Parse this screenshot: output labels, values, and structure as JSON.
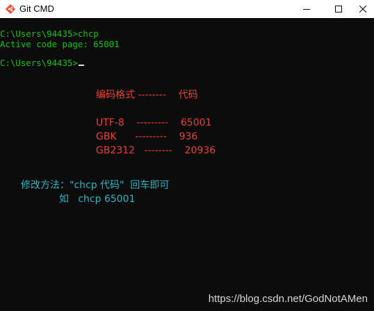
{
  "window": {
    "title": "Git CMD",
    "app_icon": "git-diamond-icon",
    "controls": {
      "minimize": "minimize-icon",
      "maximize": "maximize-icon",
      "close": "close-icon"
    }
  },
  "terminal": {
    "lines": [
      "C:\\Users\\94435>chcp",
      "Active code page: 65001",
      "C:\\Users\\94435>"
    ],
    "text_color": "#13c413",
    "background": "#0c0c0c"
  },
  "annotation": {
    "header": "编码格式 --------    代码",
    "rows": [
      "UTF-8    ---------    65001",
      "GBK      ---------    936",
      "GB2312   --------    20936"
    ],
    "method": "修改方法：\"chcp 代码\"  回车即可",
    "example": "如   chcp 65001",
    "colors": {
      "table": "#e8413b",
      "method": "#2fb3c2"
    }
  },
  "watermark": "https://blog.csdn.net/GodNotAMen"
}
